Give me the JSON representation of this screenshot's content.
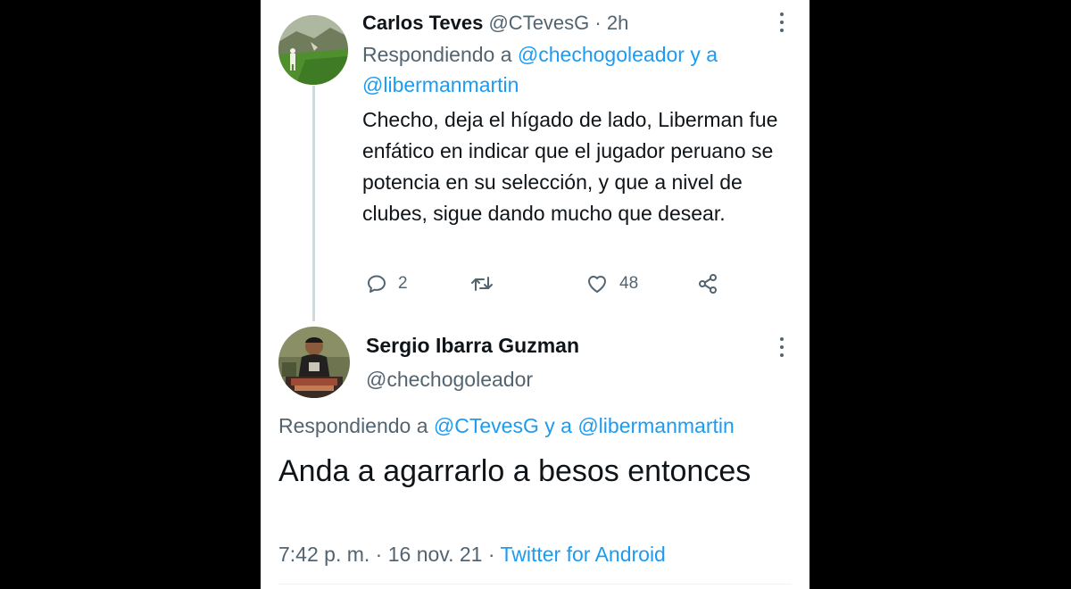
{
  "tweet1": {
    "author_name": "Carlos Teves",
    "handle": "@CTevesG",
    "separator": " · ",
    "time": "2h",
    "replying_prefix": "Respondiendo a ",
    "replying_user1": "@chechogoleador",
    "replying_join": " y a",
    "replying_user2": "@libermanmartin",
    "text": "Checho, deja el hígado de lado, Liberman fue enfático en indicar que el jugador peruano se potencia en su selección, y que a nivel de clubes, sigue dando mucho que desear.",
    "reply_count": "2",
    "retweet_count": "",
    "like_count": "48"
  },
  "tweet2": {
    "author_name": "Sergio Ibarra Guzman",
    "handle": "@chechogoleador",
    "replying_prefix": "Respondiendo a ",
    "replying_user1": "@CTevesG",
    "replying_join": " y a ",
    "replying_user2": "@libermanmartin",
    "text": "Anda a agarrarlo a besos entonces",
    "time": "7:42 p. m.",
    "meta_separator1": " · ",
    "date": "16 nov. 21",
    "meta_separator2": " · ",
    "source": "Twitter for Android"
  },
  "colors": {
    "accent": "#1d9bf0",
    "text_primary": "#0f1419",
    "text_secondary": "#536471",
    "thread_line": "#cfd9de",
    "background": "#ffffff",
    "frame": "#000000"
  },
  "icons": {
    "reply": "speech-bubble-icon",
    "retweet": "retweet-arrows-icon",
    "like": "heart-outline-icon",
    "share": "share-nodes-icon",
    "more": "vertical-ellipsis-icon"
  }
}
